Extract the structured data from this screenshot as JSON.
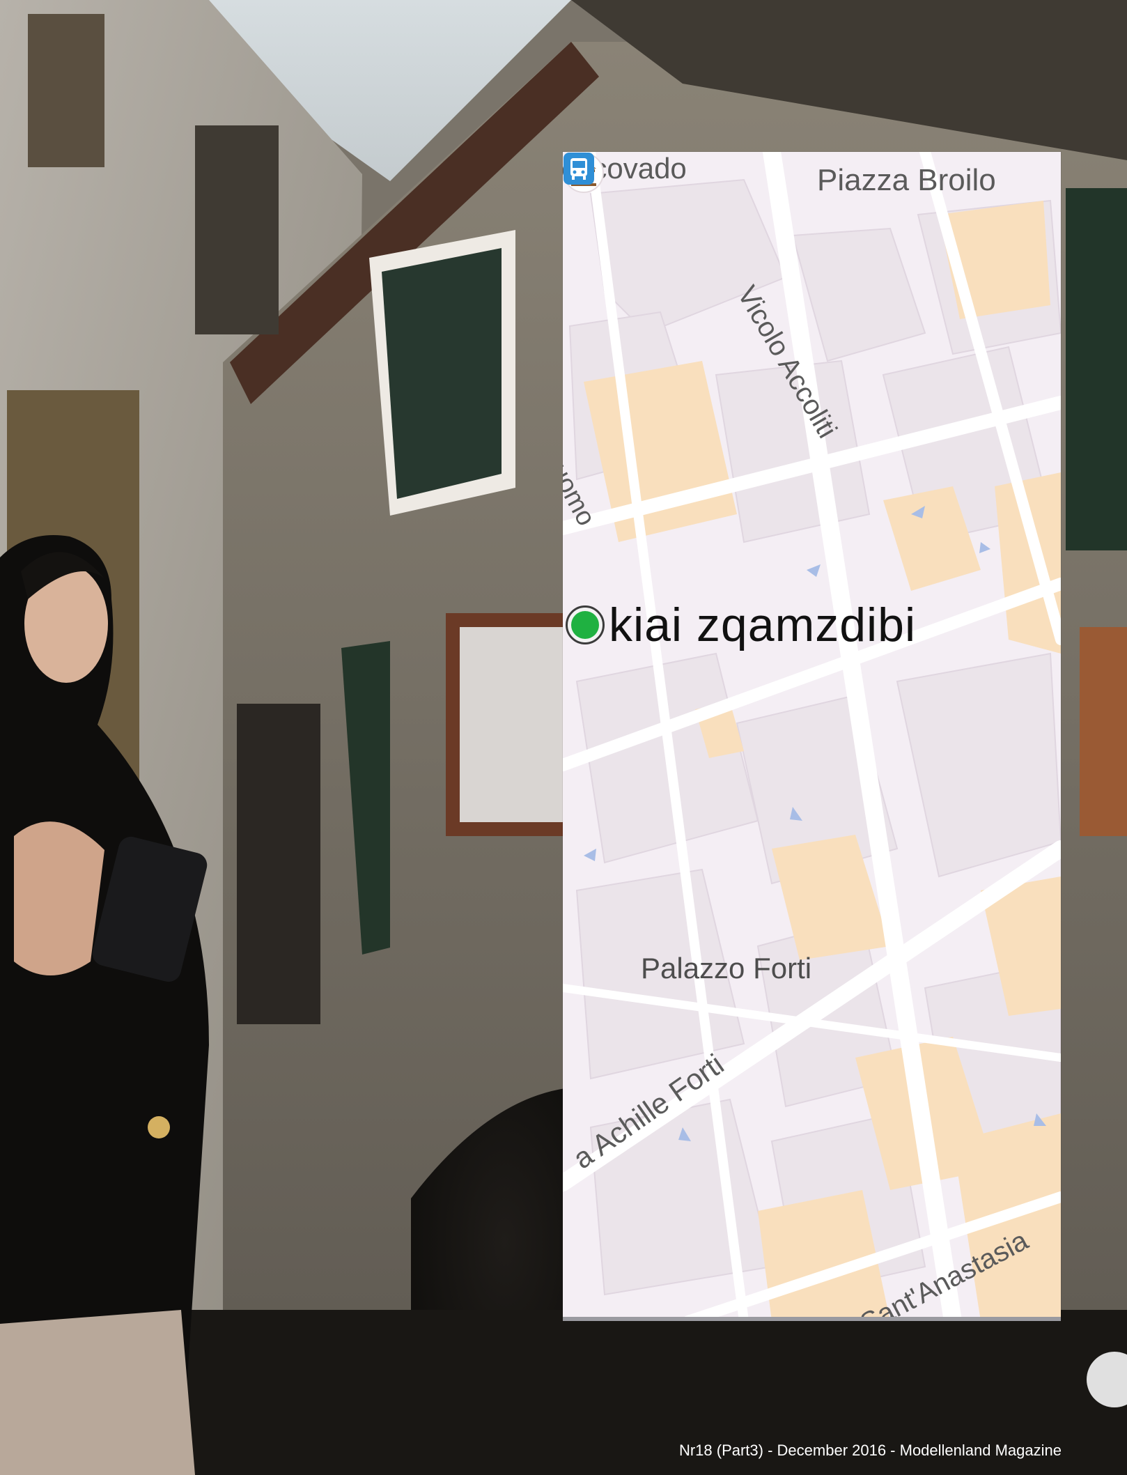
{
  "map": {
    "labels": {
      "escovado": "escovado",
      "piazza_broilo": "Piazza Broilo",
      "vicolo_accoliti": "Vicolo Accoliti",
      "duomo": "uomo",
      "location_name": "kiai zqamzdibi",
      "palazzo_forti": "Palazzo Forti",
      "achille_forti": "a Achille Forti",
      "sant_anastasia": "Sant'Anastasia"
    },
    "icons": {
      "location_pin": "location-pin-icon",
      "museum": "museum-icon",
      "bus_stop": "bus-stop-icon"
    },
    "colors": {
      "land": "#f4eef4",
      "blocks": "#ebe4ea",
      "highlight_blocks": "#f9dfbd",
      "roads": "#ffffff",
      "pin": "#1fb141",
      "bus": "#2f8fd6",
      "museum": "#8a5a2e"
    }
  },
  "footer": {
    "text": "Nr18 (Part3) - December 2016 - Modellenland Magazine"
  }
}
